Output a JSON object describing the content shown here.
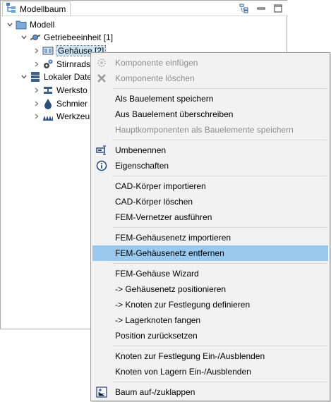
{
  "panel": {
    "title": "Modellbaum",
    "tools": [
      "tree-layout-icon",
      "minimize-icon",
      "maximize-icon"
    ]
  },
  "tree": {
    "model": "Modell",
    "gear_unit": "Getriebeeinheit [1]",
    "housing": "Gehäuse [2]",
    "spur_gear": "Stirnrads",
    "local_data": "Lokaler Date",
    "material": "Werksto",
    "lubricant": "Schmier",
    "tool": "Werkzeu"
  },
  "menu": {
    "items": [
      {
        "label": "Komponente einfügen",
        "icon": "insert-component-icon",
        "disabled": true
      },
      {
        "label": "Komponente löschen",
        "icon": "delete-x-icon",
        "disabled": true
      },
      {
        "label": "Als Bauelement speichern"
      },
      {
        "label": "Aus Bauelement überschreiben"
      },
      {
        "label": "Hauptkomponenten als Bauelemente speichern",
        "disabled": true
      },
      {
        "label": "Umbenennen",
        "icon": "rename-icon"
      },
      {
        "label": "Eigenschaften",
        "icon": "info-icon"
      },
      {
        "label": "CAD-Körper importieren"
      },
      {
        "label": "CAD-Körper löschen"
      },
      {
        "label": "FEM-Vernetzer ausführen"
      },
      {
        "label": "FEM-Gehäusenetz importieren"
      },
      {
        "label": "FEM-Gehäusenetz entfernen",
        "highlighted": true
      },
      {
        "label": "FEM-Gehäuse Wizard"
      },
      {
        "label": "->  Gehäusenetz positionieren"
      },
      {
        "label": "->  Knoten zur Festlegung definieren"
      },
      {
        "label": "->  Lagerknoten fangen"
      },
      {
        "label": "Position zurücksetzen"
      },
      {
        "label": "Knoten zur Festlegung Ein-/Ausblenden"
      },
      {
        "label": "Knoten von Lagern Ein-/Ausblenden"
      },
      {
        "label": "Baum auf-/zuklappen",
        "icon": "tree-expand-icon"
      }
    ]
  },
  "colors": {
    "highlight": "#99c9ef",
    "menu_bg": "#f2f2f2",
    "disabled_text": "#8d8d8d",
    "tree_selection": "#cce4f7"
  }
}
